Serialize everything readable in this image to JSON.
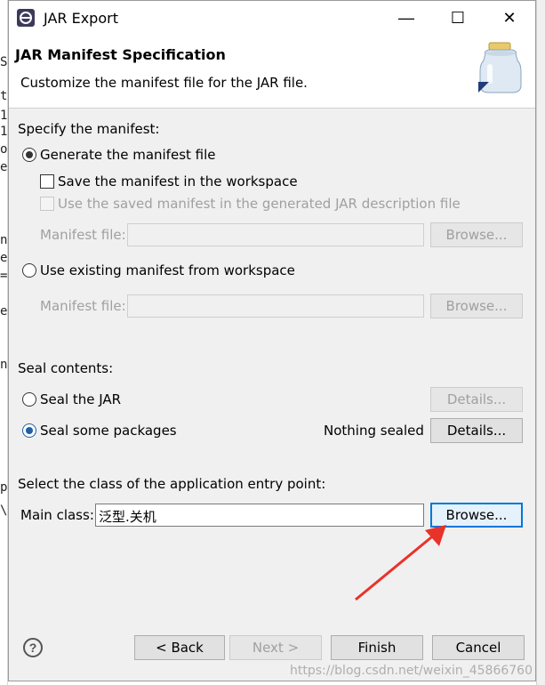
{
  "window": {
    "title": "JAR Export",
    "minimize_glyph": "—",
    "maximize_glyph": "☐",
    "close_glyph": "✕"
  },
  "header": {
    "title": "JAR Manifest Specification",
    "subtitle": "Customize the manifest file for the JAR file."
  },
  "manifest": {
    "section_label": "Specify the manifest:",
    "generate_label": "Generate the manifest file",
    "save_label": "Save the manifest in the workspace",
    "use_saved_label": "Use the saved manifest in the generated JAR description file",
    "manifest_file_label_1": "Manifest file:",
    "browse_1": "Browse...",
    "use_existing_label": "Use existing manifest from workspace",
    "manifest_file_label_2": "Manifest file:",
    "browse_2": "Browse..."
  },
  "seal": {
    "section_label": "Seal contents:",
    "seal_jar_label": "Seal the JAR",
    "details_1": "Details...",
    "seal_some_label": "Seal some packages",
    "nothing_sealed": "Nothing sealed",
    "details_2": "Details..."
  },
  "entry": {
    "section_label": "Select the class of the application entry point:",
    "main_class_label": "Main class:",
    "main_class_value": "泛型.关机",
    "browse": "Browse..."
  },
  "footer": {
    "help": "?",
    "back": "< Back",
    "next": "Next >",
    "finish": "Finish",
    "cancel": "Cancel"
  },
  "watermark": "https://blog.csdn.net/weixin_45866760",
  "colors": {
    "dialog_bg": "#f0f0f0",
    "focus_border": "#0078d7",
    "arrow": "#e8322a"
  }
}
